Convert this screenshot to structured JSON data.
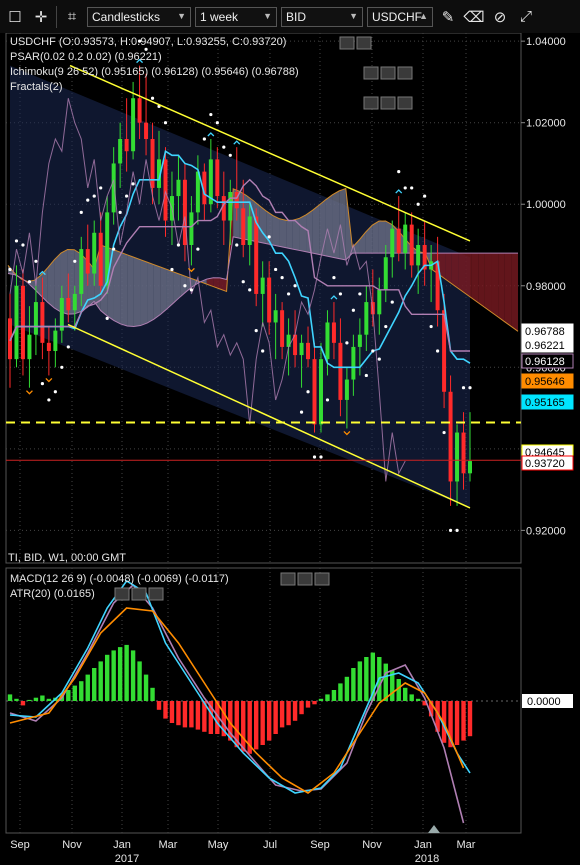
{
  "toolbar": {
    "chart_type": "Candlesticks",
    "timeframe": "1 week",
    "price_side": "BID",
    "symbol": "USDCHF",
    "icons": [
      "checkbox-icon",
      "crosshair-icon",
      "crop-icon",
      "pencil-icon",
      "eraser-icon",
      "magnet-icon",
      "fullscreen-icon"
    ]
  },
  "main_panel": {
    "legend": [
      "USDCHF (O:0.93573, H:0.94907, L:0.93255, C:0.93720)",
      "PSAR(0.02 0.2 0.02) (0.96221)",
      "Ichimoku(9 26 52) (0.95165) (0.96128) (0.95646) (0.96788)",
      "Fractals(2)"
    ],
    "footer_label": "TI, BID, W1, 00:00 GMT",
    "y_ticks": [
      "1.04000",
      "1.02000",
      "1.00000",
      "0.98000",
      "0.96000",
      "0.94000",
      "0.92000"
    ],
    "price_tags": [
      {
        "value": "0.96788",
        "bg": "#ffffff",
        "fg": "#000000",
        "border": "#ffffff"
      },
      {
        "value": "0.96221",
        "bg": "#ffffff",
        "fg": "#000000",
        "border": "#ffffff"
      },
      {
        "value": "0.96128",
        "bg": "#000000",
        "fg": "#ffffff",
        "border": "#b07fb3"
      },
      {
        "value": "0.95646",
        "bg": "#ff8c00",
        "fg": "#000000",
        "border": "#ff8c00"
      },
      {
        "value": "0.95165",
        "bg": "#00e5ff",
        "fg": "#000000",
        "border": "#00e5ff"
      },
      {
        "value": "0.94645",
        "bg": "#ffffff",
        "fg": "#000000",
        "border": "#ffff00"
      },
      {
        "value": "0.93720",
        "bg": "#ffffff",
        "fg": "#000000",
        "border": "#ff0000"
      }
    ]
  },
  "sub_panel": {
    "legend": [
      "MACD(12 26 9) (-0.0048) (-0.0069) (-0.0117)",
      "ATR(20) (0.0165)"
    ],
    "zero_tag": "0.0000"
  },
  "x_axis": {
    "months": [
      "Sep",
      "Nov",
      "Jan",
      "Mar",
      "May",
      "Jul",
      "Sep",
      "Nov",
      "Jan",
      "Mar"
    ],
    "years": [
      "2017",
      "2018"
    ]
  },
  "colors": {
    "bull": "#33dd33",
    "bear": "#ff2a2a",
    "channel": "#ffff33",
    "tenkan": "#3fd4ff",
    "kijun": "#b07fb3",
    "chikou": "#b07fb3",
    "cloud_bull": "#6a6f86",
    "cloud_bear": "#7a1a22",
    "macd_line": "#3fd4ff",
    "signal_line": "#ff8c00",
    "atr_line": "#b07fb3",
    "hist_pos": "#33dd33",
    "hist_neg": "#ff2a2a"
  },
  "chart_data": {
    "type": "candlestick",
    "title": "USDCHF",
    "timeframe": "W1",
    "ylim": [
      0.912,
      1.042
    ],
    "ohlc": [
      [
        0.972,
        0.978,
        0.955,
        0.962
      ],
      [
        0.962,
        0.985,
        0.96,
        0.98
      ],
      [
        0.98,
        0.984,
        0.958,
        0.962
      ],
      [
        0.962,
        0.975,
        0.955,
        0.968
      ],
      [
        0.968,
        0.98,
        0.963,
        0.976
      ],
      [
        0.976,
        0.982,
        0.962,
        0.966
      ],
      [
        0.966,
        0.97,
        0.958,
        0.964
      ],
      [
        0.964,
        0.972,
        0.96,
        0.969
      ],
      [
        0.969,
        0.98,
        0.966,
        0.977
      ],
      [
        0.977,
        0.983,
        0.971,
        0.974
      ],
      [
        0.974,
        0.98,
        0.969,
        0.978
      ],
      [
        0.978,
        0.992,
        0.975,
        0.989
      ],
      [
        0.989,
        0.995,
        0.98,
        0.983
      ],
      [
        0.983,
        0.996,
        0.98,
        0.993
      ],
      [
        0.993,
        0.998,
        0.978,
        0.98
      ],
      [
        0.98,
        1.002,
        0.978,
        0.998
      ],
      [
        0.998,
        1.014,
        0.995,
        1.01
      ],
      [
        1.01,
        1.02,
        1.004,
        1.016
      ],
      [
        1.016,
        1.026,
        1.008,
        1.013
      ],
      [
        1.013,
        1.03,
        1.011,
        1.026
      ],
      [
        1.026,
        1.034,
        1.016,
        1.02
      ],
      [
        1.02,
        1.032,
        1.012,
        1.016
      ],
      [
        1.016,
        1.02,
        1.0,
        1.004
      ],
      [
        1.004,
        1.018,
        1.0,
        1.011
      ],
      [
        1.011,
        1.014,
        0.992,
        0.996
      ],
      [
        0.996,
        1.008,
        0.99,
        1.002
      ],
      [
        1.002,
        1.012,
        0.996,
        1.006
      ],
      [
        1.006,
        1.01,
        0.986,
        0.99
      ],
      [
        0.99,
        1.002,
        0.985,
        0.998
      ],
      [
        0.998,
        1.012,
        0.995,
        1.008
      ],
      [
        1.008,
        1.01,
        0.996,
        1.0
      ],
      [
        1.0,
        1.016,
        0.998,
        1.011
      ],
      [
        1.011,
        1.014,
        0.999,
        1.002
      ],
      [
        1.002,
        1.008,
        0.99,
        0.996
      ],
      [
        0.996,
        1.006,
        0.99,
        1.003
      ],
      [
        1.003,
        1.014,
        0.996,
        0.999
      ],
      [
        0.999,
        1.006,
        0.987,
        0.99
      ],
      [
        0.99,
        1.0,
        0.985,
        0.997
      ],
      [
        0.997,
        0.999,
        0.975,
        0.978
      ],
      [
        0.978,
        0.986,
        0.97,
        0.982
      ],
      [
        0.982,
        0.986,
        0.968,
        0.971
      ],
      [
        0.971,
        0.978,
        0.962,
        0.974
      ],
      [
        0.974,
        0.976,
        0.962,
        0.965
      ],
      [
        0.965,
        0.972,
        0.958,
        0.968
      ],
      [
        0.968,
        0.974,
        0.96,
        0.963
      ],
      [
        0.963,
        0.968,
        0.955,
        0.966
      ],
      [
        0.966,
        0.97,
        0.96,
        0.962
      ],
      [
        0.962,
        0.966,
        0.944,
        0.946
      ],
      [
        0.946,
        0.966,
        0.944,
        0.962
      ],
      [
        0.962,
        0.974,
        0.958,
        0.971
      ],
      [
        0.971,
        0.976,
        0.962,
        0.966
      ],
      [
        0.966,
        0.972,
        0.948,
        0.952
      ],
      [
        0.952,
        0.96,
        0.945,
        0.957
      ],
      [
        0.957,
        0.968,
        0.953,
        0.965
      ],
      [
        0.965,
        0.972,
        0.958,
        0.968
      ],
      [
        0.968,
        0.98,
        0.964,
        0.976
      ],
      [
        0.976,
        0.984,
        0.97,
        0.973
      ],
      [
        0.973,
        0.982,
        0.968,
        0.979
      ],
      [
        0.979,
        0.99,
        0.976,
        0.987
      ],
      [
        0.987,
        0.996,
        0.982,
        0.994
      ],
      [
        0.994,
        1.002,
        0.986,
        0.988
      ],
      [
        0.988,
        0.998,
        0.984,
        0.995
      ],
      [
        0.995,
        0.998,
        0.982,
        0.985
      ],
      [
        0.985,
        0.994,
        0.978,
        0.99
      ],
      [
        0.99,
        0.996,
        0.98,
        0.984
      ],
      [
        0.984,
        0.99,
        0.976,
        0.986
      ],
      [
        0.986,
        0.992,
        0.97,
        0.974
      ],
      [
        0.974,
        0.978,
        0.95,
        0.954
      ],
      [
        0.954,
        0.958,
        0.926,
        0.932
      ],
      [
        0.932,
        0.946,
        0.926,
        0.944
      ],
      [
        0.944,
        0.949,
        0.93,
        0.934
      ],
      [
        0.934,
        0.949,
        0.932,
        0.937
      ]
    ],
    "series_latest": {
      "psar": 0.96221,
      "tenkan": 0.95165,
      "kijun": 0.96128,
      "senkou_a": 0.95646,
      "senkou_b": 0.96788
    },
    "horizontal_levels": [
      0.94645,
      0.9372
    ],
    "macd_latest": {
      "macd": -0.0048,
      "signal": -0.0069,
      "hist": -0.0117
    },
    "atr_latest": 0.0165
  }
}
